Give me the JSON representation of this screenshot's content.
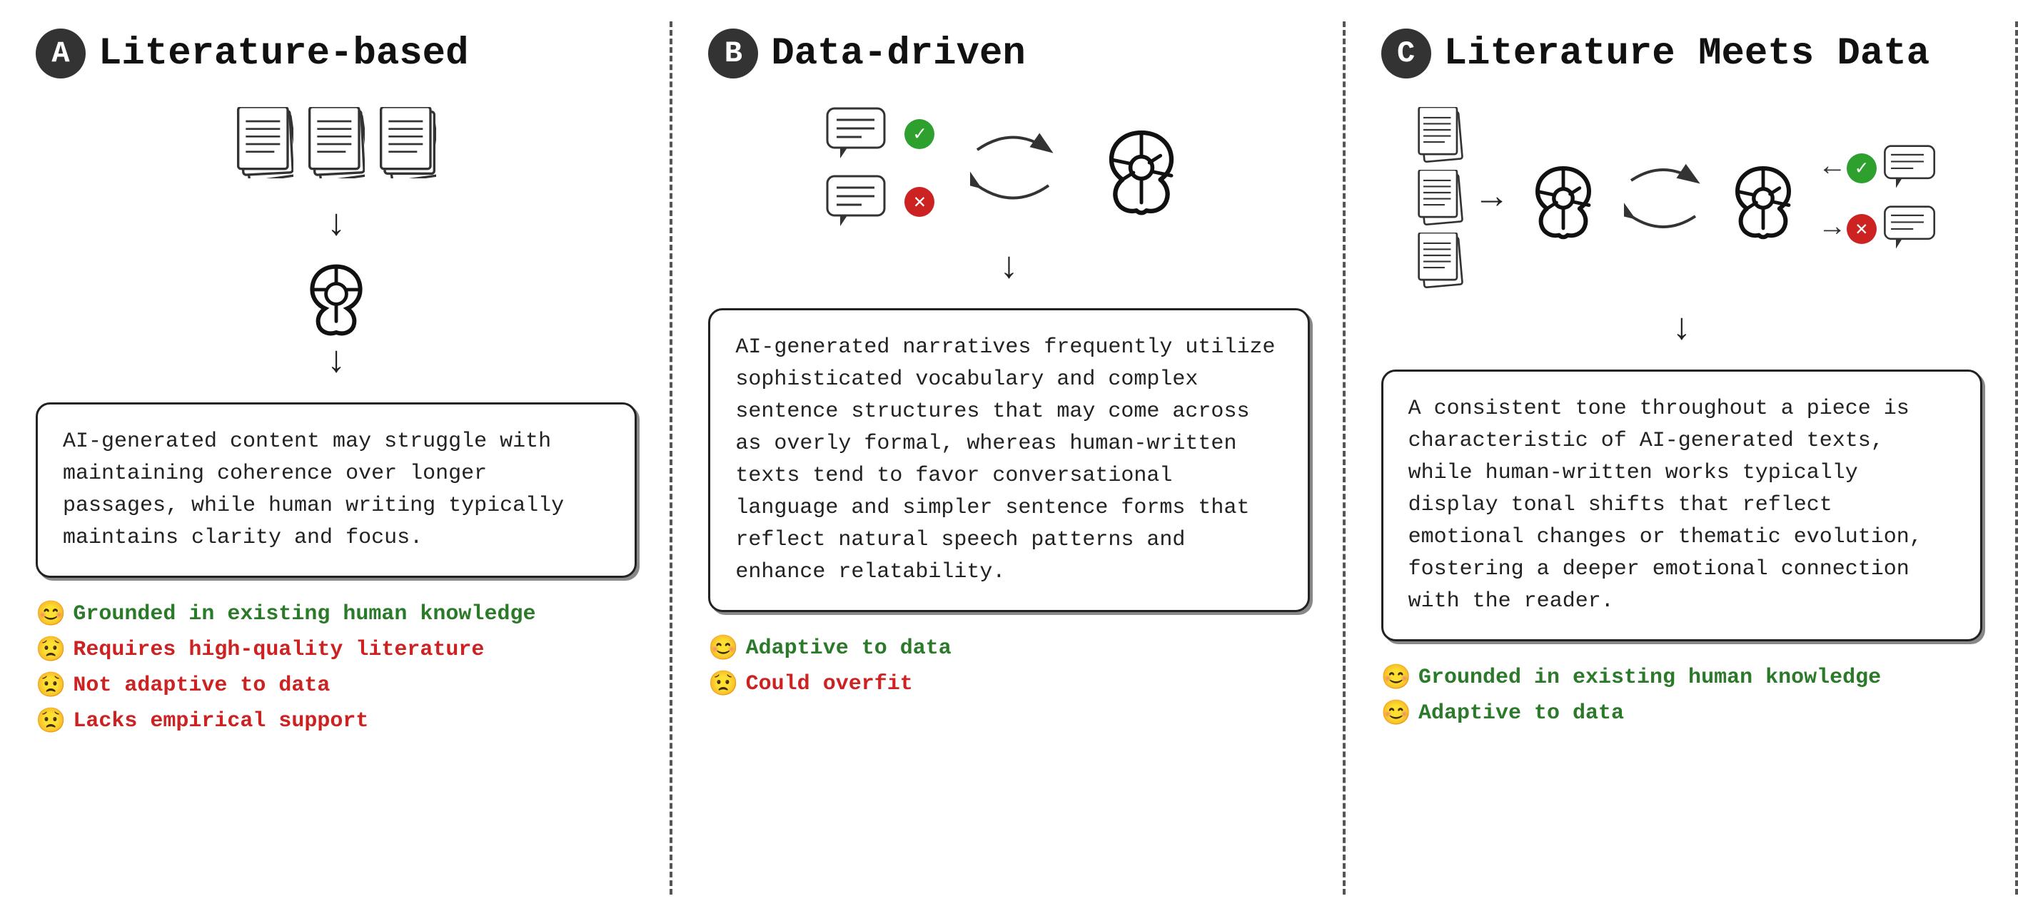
{
  "panels": [
    {
      "id": "A",
      "title": "Literature-based",
      "description": "AI-generated content may struggle with maintaining coherence over longer passages, while human writing typically maintains clarity and focus.",
      "pros": [
        {
          "type": "good",
          "emoji": "😊",
          "text": "Grounded in existing human  knowledge"
        },
        {
          "type": "bad",
          "emoji": "😟",
          "text": "Requires high-quality literature"
        },
        {
          "type": "bad",
          "emoji": "😟",
          "text": "Not adaptive to data"
        },
        {
          "type": "bad",
          "emoji": "😟",
          "text": "Lacks empirical  support"
        }
      ]
    },
    {
      "id": "B",
      "title": "Data-driven",
      "description": "AI-generated narratives frequently utilize sophisticated vocabulary and complex sentence structures that may come across as overly formal, whereas human-written texts tend to favor conversational language and simpler sentence forms that reflect natural speech patterns and enhance relatability.",
      "pros": [
        {
          "type": "good",
          "emoji": "😊",
          "text": "Adaptive to data"
        },
        {
          "type": "bad",
          "emoji": "😟",
          "text": "Could overfit"
        }
      ]
    },
    {
      "id": "C",
      "title": "Literature Meets Data",
      "description": "A consistent tone throughout a piece is characteristic of AI-generated texts, while human-written works typically display tonal shifts that reflect emotional changes or thematic evolution, fostering a deeper emotional connection with the reader.",
      "pros": [
        {
          "type": "good",
          "emoji": "😊",
          "text": "Grounded in existing human knowledge"
        },
        {
          "type": "good",
          "emoji": "😊",
          "text": "Adaptive to data"
        }
      ]
    }
  ]
}
